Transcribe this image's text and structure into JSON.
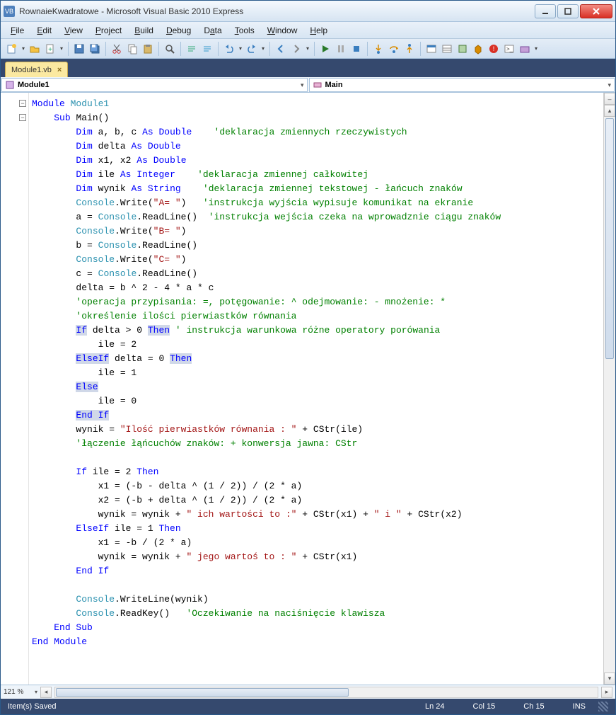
{
  "window": {
    "title": "RownaieKwadratowe - Microsoft Visual Basic 2010 Express",
    "app_icon_label": "VB"
  },
  "menu": {
    "file": "File",
    "edit": "Edit",
    "view": "View",
    "project": "Project",
    "build": "Build",
    "debug": "Debug",
    "data": "Data",
    "tools": "Tools",
    "window": "Window",
    "help": "Help"
  },
  "tab": {
    "filename": "Module1.vb",
    "close": "×"
  },
  "scope_dropdown": {
    "left": "Module1",
    "right": "Main"
  },
  "zoom": {
    "value": "121 %"
  },
  "status": {
    "left": "Item(s) Saved",
    "ln": "Ln 24",
    "col": "Col 15",
    "ch": "Ch 15",
    "ins": "INS"
  },
  "icons": {
    "new": "new-project-icon",
    "open": "open-file-icon",
    "add": "add-item-icon",
    "save": "save-icon",
    "saveall": "save-all-icon",
    "cut": "cut-icon",
    "copy": "copy-icon",
    "paste": "paste-icon",
    "find": "find-icon",
    "commentout": "comment-out-icon",
    "uncomment": "uncomment-icon",
    "undo": "undo-icon",
    "redo": "redo-icon",
    "run": "start-debug-icon",
    "pause": "pause-icon",
    "stop": "stop-icon",
    "stepinto": "step-into-icon",
    "stepover": "step-over-icon",
    "stepout": "step-out-icon"
  },
  "code": {
    "module_decl": "Module",
    "module_name": "Module1",
    "sub_decl": "Sub",
    "main_name": "Main()",
    "dim_kw": "Dim",
    "as_kw": "As",
    "double_tp": "Double",
    "integer_tp": "Integer",
    "string_tp": "String",
    "if_kw": "If",
    "then_kw": "Then",
    "elseif_kw": "ElseIf",
    "else_kw": "Else",
    "endif_kw": "End If",
    "endsub_kw": "End Sub",
    "endmodule_kw": "End Module",
    "vars_abc": "a, b, c",
    "var_delta": "delta",
    "vars_x": "x1, x2",
    "var_ile": "ile",
    "var_wynik": "wynik",
    "cm_real": "'deklaracja zmiennych rzeczywistych",
    "cm_int": "'deklaracja zmiennej całkowitej",
    "cm_str": "'deklaracja zmiennej tekstowej - łańcuch znaków",
    "cm_out": "'instrukcja wyjścia wypisuje komunikat na ekranie",
    "cm_in": "'instrukcja wejścia czeka na wprowadznie ciągu znaków",
    "cm_op": "'operacja przypisania: =, potęgowanie: ^ odejmowanie: - mnożenie: *",
    "cm_roots": "'określenie ilości pierwiastków równania",
    "cm_cond": "' instrukcja warunkowa różne operatory porówania",
    "cm_concat": "'łączenie łąńcuchów znaków: + konwersja jawna: CStr",
    "cm_wait": "'Oczekiwanie na naciśnięcie klawisza",
    "console_write_a": ".Write(",
    "str_a": "\"A= \"",
    "paren_close": ")",
    "str_b": "\"B= \"",
    "str_c": "\"C= \"",
    "assign_a": "a = ",
    "assign_b": "b = ",
    "assign_c": "c = ",
    "readline": ".ReadLine()",
    "delta_expr": "delta = b ^ 2 - 4 * a * c",
    "cond_gt0": " delta > 0 ",
    "cond_eq0": " delta = 0 ",
    "ile2": "ile = 2",
    "ile1": "ile = 1",
    "ile0": "ile = 0",
    "wynik_eq": "wynik = ",
    "str_roots": "\"Ilość pierwiastków równania : \"",
    "plus_cstr_ile": " + CStr(ile)",
    "cond_ile2": " ile = 2 ",
    "cond_ile1": " ile = 1 ",
    "x1_expr2": "x1 = (-b - delta ^ (1 / 2)) / (2 * a)",
    "x2_expr2": "x2 = (-b + delta ^ (1 / 2)) / (2 * a)",
    "wynik_plus": "wynik = wynik + ",
    "str_values": "\" ich wartości to :\"",
    "plus_cstr_x1": " + CStr(x1) + ",
    "str_i": "\" i \"",
    "plus_cstr_x2": " + CStr(x2)",
    "x1_expr1": "x1 = -b / (2 * a)",
    "str_value1": "\" jego wartoś to : \"",
    "plus_cstr_x1b": " + CStr(x1)",
    "writeline": ".WriteLine(wynik)",
    "readkey": ".ReadKey()   ",
    "console_tp": "Console"
  }
}
